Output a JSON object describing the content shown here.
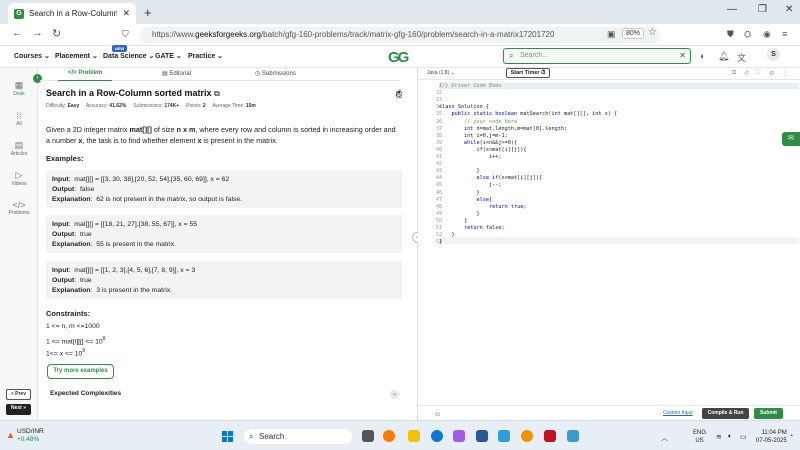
{
  "browser": {
    "tab_title": "Search in a Row-Column sorted",
    "tab_close": "✕",
    "new_tab": "+",
    "url_prefix": "https://www.",
    "url_host": "geeksforgeeks.org",
    "url_path": "/batch/gfg-160-problems/track/matrix-gfg-160/problem/search-in-a-matrix17201720",
    "zoom": "80%"
  },
  "site_nav": {
    "items": [
      "Courses ⌄",
      "Placement ⌄",
      "Data Science ⌄",
      "GATE ⌄",
      "Practice ⌄"
    ],
    "badge": "NEW",
    "logo": "GG",
    "search_placeholder": "Search...",
    "avatar_initial": "S"
  },
  "left_sidebar": {
    "items": [
      "Desk",
      "All",
      "Articles",
      "Videos",
      "Problems"
    ],
    "prev_label": "« Prev",
    "next_label": "Next »"
  },
  "problem_tabs": [
    "Problem",
    "Editorial",
    "Submissions"
  ],
  "problem": {
    "title": "Search in a Row-Column sorted matrix",
    "meta_difficulty_label": "Difficulty:",
    "meta_difficulty": "Easy",
    "meta_accuracy_label": "Accuracy:",
    "meta_accuracy": "41.62%",
    "meta_submissions_label": "Submissions:",
    "meta_submissions": "174K+",
    "meta_points_label": "Points:",
    "meta_points": "2",
    "meta_time_label": "Average Time:",
    "meta_time": "15m",
    "description_1": "Given a 2D integer matrix ",
    "description_2": "mat[][]",
    "description_3": " of size ",
    "description_4": "n x m",
    "description_5": ", where every row and column is sorted in increasing order and a number ",
    "description_6": "x",
    "description_7": ", the task is to find whether element ",
    "description_8": "x",
    "description_9": " is present in the matrix.",
    "examples_heading": "Examples:",
    "examples": [
      {
        "input": "mat[][] = [[3, 30, 38],[20, 52, 54],[35, 60, 69]], x = 62",
        "output": "false",
        "explanation": "62 is not present in the matrix, so output is false."
      },
      {
        "input": "mat[][] = [[18, 21, 27],[38, 55, 67]], x = 55",
        "output": "true",
        "explanation": "55 is present in the matrix."
      },
      {
        "input": "mat[][] = [[1, 2, 3],[4, 5, 6],[7, 8, 9]], x = 3",
        "output": "true",
        "explanation": "3 is present in the matrix."
      }
    ],
    "input_label": "Input",
    "output_label": "Output",
    "explanation_label": "Explanation",
    "constraints_heading": "Constraints:",
    "constraint_1": "1 <= n, m <=1000",
    "constraint_2": "1 <= mat[i][j] <= 10",
    "constraint_2_sup": "9",
    "constraint_3": "1<= x <= 10",
    "constraint_3_sup": "9",
    "try_more": "Try more examples",
    "expected_complexities": "Expected Complexities"
  },
  "editor": {
    "language": "Java (1.8)",
    "start_timer": "Start Timer ⏱",
    "lines": [
      {
        "n": "1",
        "text": "//} Driver Code Ends"
      },
      {
        "n": "32",
        "text": ""
      },
      {
        "n": "33",
        "text": ""
      },
      {
        "n": "34",
        "text": "class Solution {"
      },
      {
        "n": "35",
        "text": "    public static boolean matSearch(int mat[][], int x) {"
      },
      {
        "n": "36",
        "text": "        // your code here"
      },
      {
        "n": "37",
        "text": "        int n=mat.length,m=mat[0].length;"
      },
      {
        "n": "38",
        "text": "        int i=0,j=m-1;"
      },
      {
        "n": "39",
        "text": "        while(i<n&&j>=0){"
      },
      {
        "n": "40",
        "text": "            if(x>mat[i][j]){"
      },
      {
        "n": "41",
        "text": "                i++;"
      },
      {
        "n": "42",
        "text": ""
      },
      {
        "n": "43",
        "text": "            }"
      },
      {
        "n": "44",
        "text": "            else if(x<mat[i][j]){"
      },
      {
        "n": "45",
        "text": "                j--;"
      },
      {
        "n": "46",
        "text": "            }"
      },
      {
        "n": "47",
        "text": "            else{"
      },
      {
        "n": "48",
        "text": "                return true;"
      },
      {
        "n": "49",
        "text": "            }"
      },
      {
        "n": "50",
        "text": "        }"
      },
      {
        "n": "51",
        "text": "        return false;"
      },
      {
        "n": "52",
        "text": "    }"
      },
      {
        "n": "53",
        "text": "}"
      }
    ],
    "custom_input": "Custom Input",
    "compile_run": "Compile & Run",
    "submit": "Submit"
  },
  "taskbar": {
    "ticker": "USD/INR",
    "ticker_change": "+0.48%",
    "search": "Search",
    "lang_1": "ENG",
    "lang_2": "US",
    "time": "11:04 PM",
    "date": "07-05-2025"
  }
}
